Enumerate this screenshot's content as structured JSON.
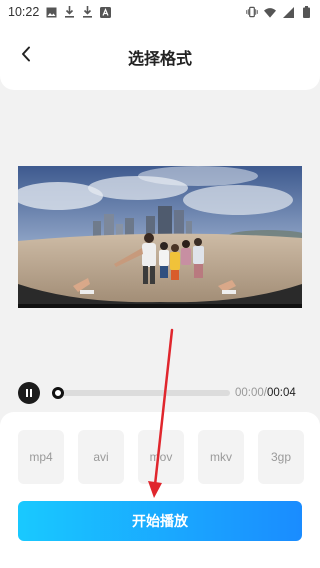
{
  "status_bar": {
    "time": "10:22",
    "left_icons": [
      "image-icon",
      "download-icon",
      "download-icon",
      "text-icon"
    ],
    "right_icons": [
      "vibrate-icon",
      "wifi-icon",
      "signal-icon",
      "battery-icon"
    ]
  },
  "header": {
    "title": "选择格式",
    "back_icon": "back-arrow-icon"
  },
  "player": {
    "current_time": "00:00",
    "separator": "/",
    "total_time": "00:04",
    "progress_fraction": 0.0,
    "pause_icon": "pause-icon"
  },
  "formats": [
    {
      "label": "mp4"
    },
    {
      "label": "avi"
    },
    {
      "label": "mov"
    },
    {
      "label": "mkv"
    },
    {
      "label": "3gp"
    }
  ],
  "start_button": {
    "label": "开始播放"
  },
  "colors": {
    "accent_start": "#19c9ff",
    "accent_end": "#1a8cff",
    "annotation_arrow": "#e0262d"
  }
}
